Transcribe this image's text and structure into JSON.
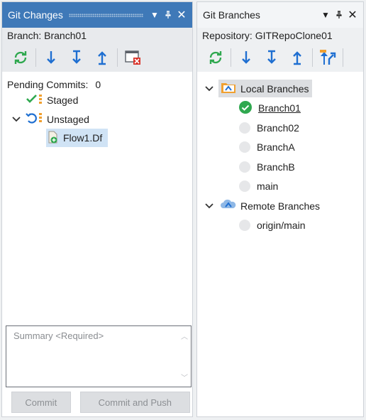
{
  "left_panel": {
    "title": "Git Changes",
    "branch_label": "Branch: Branch01",
    "toolbar": [
      "refresh-icon",
      "fetch-icon",
      "pull-icon",
      "push-icon",
      "discard-all-icon"
    ],
    "pending_label": "Pending Commits:",
    "pending_count": "0",
    "staged_label": "Staged",
    "unstaged_label": "Unstaged",
    "unstaged_files": [
      "Flow1.Df"
    ],
    "summary_placeholder": "Summary <Required>",
    "commit_label": "Commit",
    "commit_push_label": "Commit and Push"
  },
  "right_panel": {
    "title": "Git Branches",
    "repository_label": "Repository: GITRepoClone01",
    "toolbar": [
      "refresh-icon",
      "fetch-icon",
      "pull-icon",
      "push-icon",
      "branch-icon"
    ],
    "local_label": "Local Branches",
    "local_branches": [
      "Branch01",
      "Branch02",
      "BranchA",
      "BranchB",
      "main"
    ],
    "current_branch": "Branch01",
    "remote_label": "Remote Branches",
    "remote_branches": [
      "origin/main"
    ]
  },
  "colors": {
    "accent": "#3f79b8",
    "icon_blue": "#1f6fd1",
    "icon_green": "#2fa84f",
    "icon_orange": "#f0a030",
    "icon_red": "#d9342b"
  }
}
